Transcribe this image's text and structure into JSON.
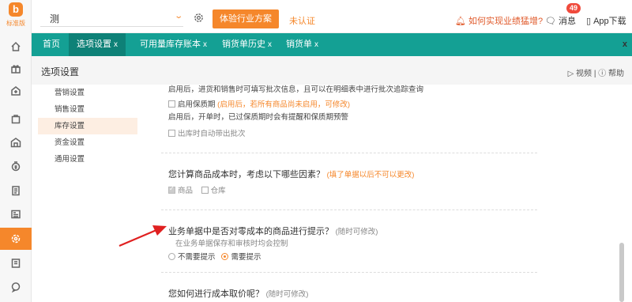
{
  "rail": {
    "logo_text": "标准版"
  },
  "topbar": {
    "company_name": "测",
    "trial_button": "体验行业方案",
    "unverified": "未认证",
    "howto_link": "如何实现业绩猛增?",
    "messages_label": "消息",
    "messages_count": "49",
    "app_download": "App下载"
  },
  "tabs": [
    {
      "label": "首页"
    },
    {
      "label": "选项设置",
      "close": "x"
    },
    {
      "label": "可用量库存账本",
      "close": "x"
    },
    {
      "label": "销货单历史",
      "close": "x"
    },
    {
      "label": "销货单",
      "close": "x"
    }
  ],
  "tabbar_close": "x",
  "page": {
    "title": "选项设置",
    "video": "视频",
    "divider": "|",
    "help": "帮助"
  },
  "nav": [
    "营销设置",
    "销售设置",
    "库存设置",
    "资金设置",
    "通用设置"
  ],
  "content": {
    "batch_note": "启用后，进货和销售时可填写批次信息，且可以在明细表中进行批次追踪查询",
    "shelf_label": "启用保质期",
    "shelf_hint": "(启用后，若所有商品尚未启用，可修改)",
    "shelf_note": "启用后，开单时，已过保质期时会有提醒和保质期预警",
    "auto_batch": "出库时自动带出批次",
    "cost_question": "您计算商品成本时，考虑以下哪些因素？",
    "cost_hint": "(填了单据以后不可以更改)",
    "cost_opt_product": "商品",
    "cost_opt_warehouse": "仓库",
    "zero_question": "业务单据中是否对零成本的商品进行提示？",
    "zero_hint": "(随时可修改)",
    "zero_note": "在业务单据保存和审核时均会控制",
    "zero_opt_no": "不需要提示",
    "zero_opt_yes": "需要提示",
    "price_question": "您如何进行成本取价呢？",
    "price_hint": "(随时可修改)"
  },
  "colors": {
    "accent": "#f5872b",
    "tabbar": "#14a094",
    "tab_active": "#0e8177",
    "arrow": "#e02020"
  }
}
